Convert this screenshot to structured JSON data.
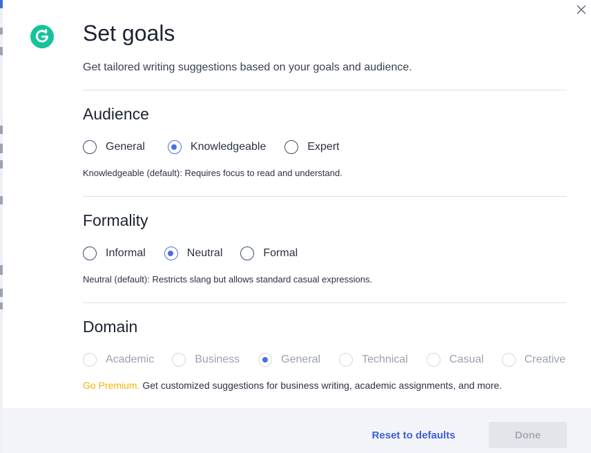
{
  "header": {
    "logo_icon": "grammarly-g-icon",
    "title": "Set goals",
    "subtitle": "Get tailored writing suggestions based on your goals and audience."
  },
  "audience": {
    "title": "Audience",
    "options": [
      "General",
      "Knowledgeable",
      "Expert"
    ],
    "selected": "Knowledgeable",
    "description_label": "Knowledgeable (default):",
    "description_text": " Requires focus to read and understand."
  },
  "formality": {
    "title": "Formality",
    "options": [
      "Informal",
      "Neutral",
      "Formal"
    ],
    "selected": "Neutral",
    "description_label": "Neutral (default):",
    "description_text": " Restricts slang but allows standard casual expressions."
  },
  "domain": {
    "title": "Domain",
    "options": [
      "Academic",
      "Business",
      "General",
      "Technical",
      "Casual",
      "Creative"
    ],
    "selected": "General",
    "premium_link": "Go Premium.",
    "premium_text": " Get customized suggestions for business writing, academic assignments, and more."
  },
  "footer": {
    "reset_label": "Reset to defaults",
    "done_label": "Done"
  },
  "colors": {
    "accent": "#4a6de5",
    "brand_green": "#15c39a",
    "premium": "#f0b400"
  }
}
